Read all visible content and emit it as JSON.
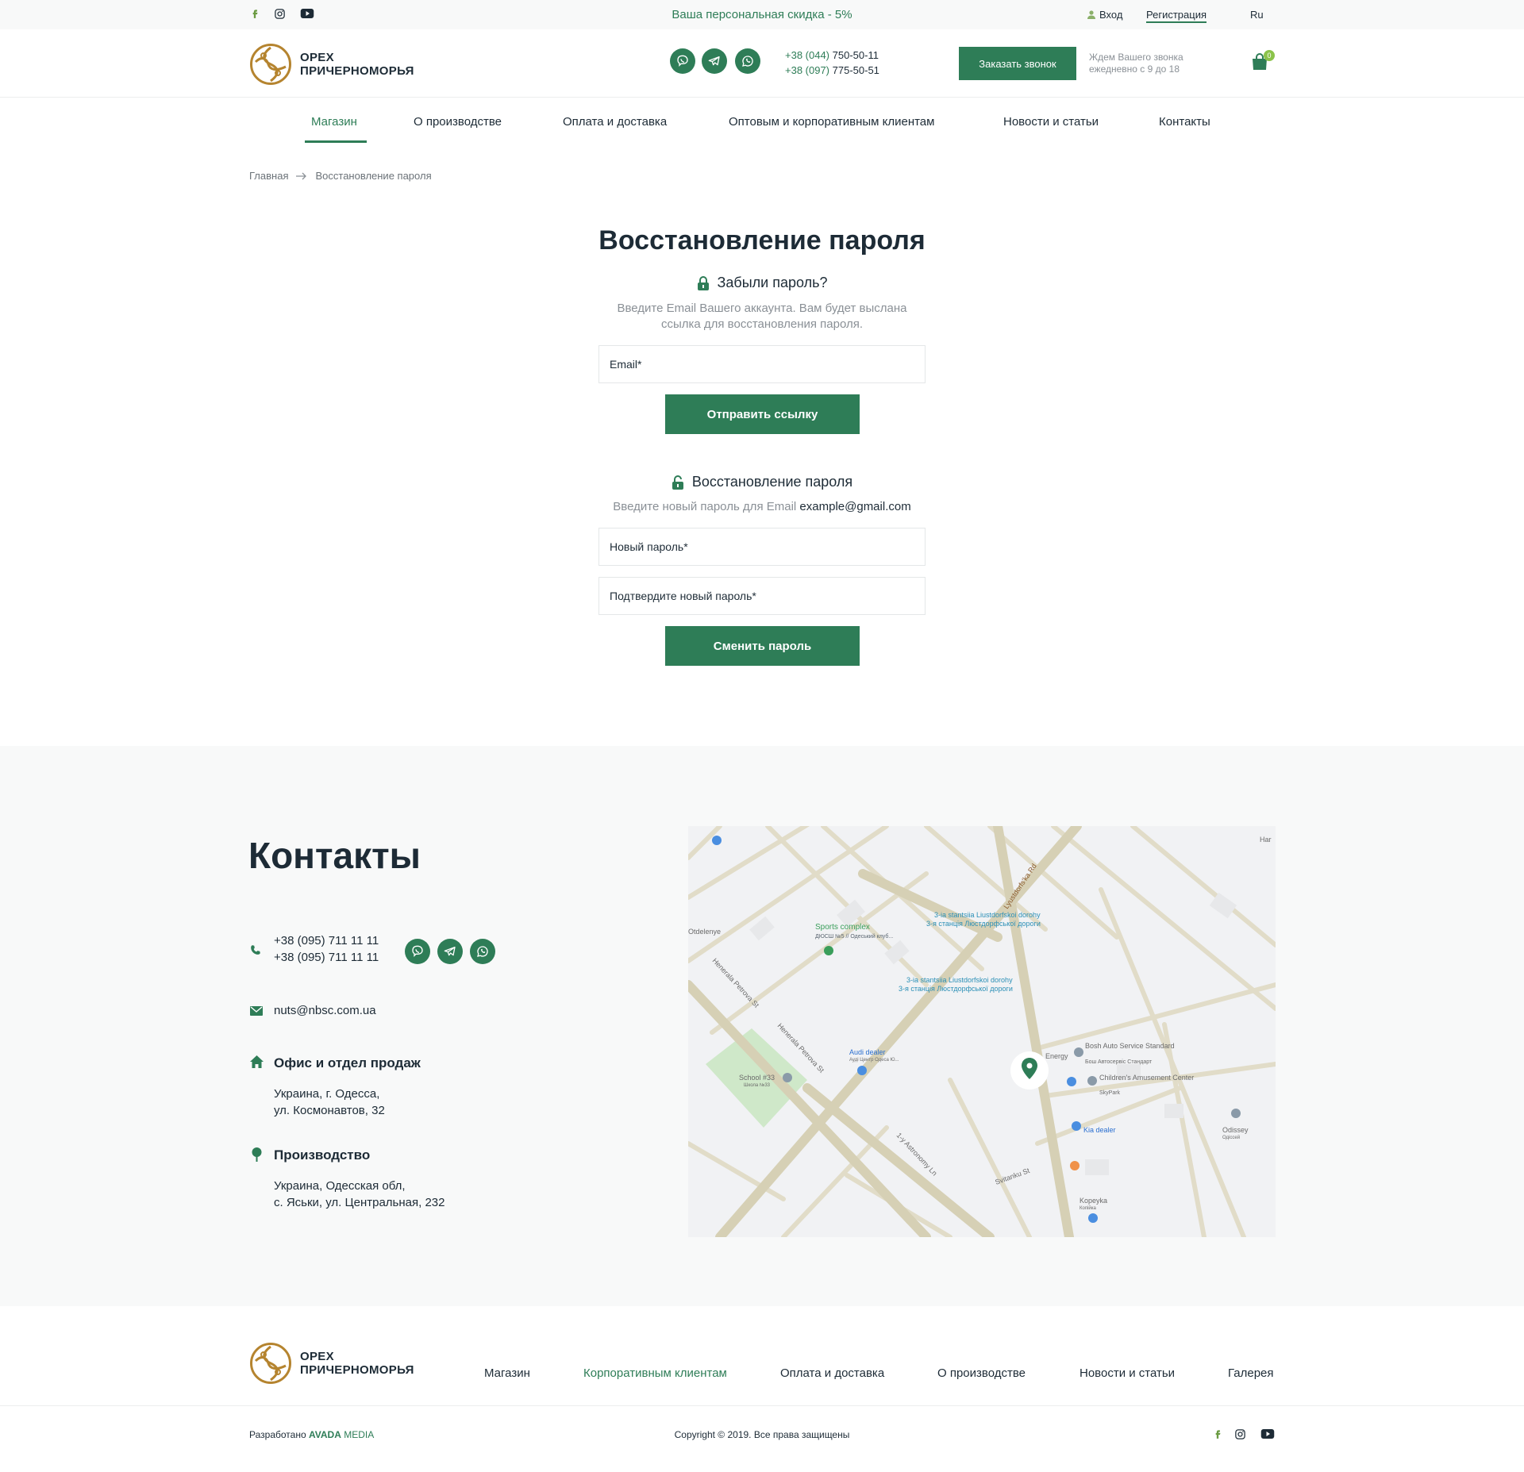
{
  "colors": {
    "accent": "#2e7d57",
    "gold": "#b5842f",
    "muted": "#8a9096"
  },
  "topbar": {
    "discount": "Ваша персональная скидка - 5%",
    "login": "Вход",
    "register": "Регистрация",
    "lang": "Ru",
    "social": [
      "facebook-icon",
      "instagram-icon",
      "youtube-icon"
    ]
  },
  "header": {
    "logo_line1": "ОРЕХ",
    "logo_line2": "ПРИЧЕРНОМОРЬЯ",
    "phone1_code": "+38 (044)",
    "phone1_number": "750-50-11",
    "phone2_code": "+38 (097)",
    "phone2_number": "775-50-51",
    "call_button": "Заказать звонок",
    "call_note_line1": "Ждем Вашего звонка",
    "call_note_line2": "ежедневно с 9 до 18",
    "cart_count": "0"
  },
  "nav": {
    "items": [
      "Магазин",
      "О производстве",
      "Оплата и доставка",
      "Оптовым и корпоративным клиентам",
      "Новости и статьи",
      "Контакты"
    ],
    "active": "Магазин"
  },
  "breadcrumb": {
    "home": "Главная",
    "current": "Восстановление пароля"
  },
  "main": {
    "title": "Восстановление пароля",
    "forgot": {
      "title": "Забыли пароль?",
      "hint_line1": "Введите Email Вашего аккаунта. Вам будет выслана",
      "hint_line2": "ссылка для восстановления пароля.",
      "email_placeholder": "Email*",
      "button": "Отправить ссылку"
    },
    "reset": {
      "title": "Восстановление пароля",
      "hint_prefix": "Введите новый пароль для Email",
      "hint_email": "example@gmail.com",
      "new_password_placeholder": "Новый пароль*",
      "confirm_password_placeholder": "Подтвердите новый пароль*",
      "button": "Сменить пароль"
    }
  },
  "contacts": {
    "title": "Контакты",
    "phone1": "+38 (095) 711 11 11",
    "phone2": "+38 (095) 711 11 11",
    "email": "nuts@nbsc.com.ua",
    "office_title": "Офис и отдел продаж",
    "office_line1": "Украина, г. Одесса,",
    "office_line2": "ул. Космонавтов, 32",
    "production_title": "Производство",
    "production_line1": "Украина, Одесская обл,",
    "production_line2": "с. Яськи, ул. Центральная, 232"
  },
  "map": {
    "labels": {
      "sports": "Sports complex",
      "sports_sub": "ДЮСШ №5 // Одеський клуб...",
      "station1": "3-ia stantsiia Liustdorfskoi dorohy",
      "station1_sub": "3-я станція Люстдорфської дороги",
      "station2": "3-ia stantsiia Liustdorfskoi dorohy",
      "station2_sub": "3-я станція Люстдорфської дороги",
      "street_lyust": "Lyustdorfs'ka Rd",
      "street_petrova1": "Henerala Petrova St",
      "street_petrova2": "Henerala Petrova St",
      "street_astronomy": "1-y Astronomy Ln",
      "street_svitanku": "Svitanku St",
      "audi": "Audi dealer",
      "audi_sub": "Ауді Центр Одеса Ю...",
      "school": "School #33",
      "school_sub": "Школа №33",
      "energy": "Energy",
      "bosh": "Bosh Auto Service Standard",
      "bosh_sub": "Бош Автосервіс Стандарт",
      "children": "Children's Amusement Center",
      "children_sub": "SkyPark",
      "kia": "Kia dealer",
      "odissey": "Odissey",
      "odissey_sub": "Одіссей",
      "kopeyka": "Kopeyka",
      "kopeyka_sub": "Копійка",
      "otdelenye": "Otdelenye",
      "har": "Har"
    }
  },
  "footer": {
    "logo_line1": "ОРЕХ",
    "logo_line2": "ПРИЧЕРНОМОРЬЯ",
    "nav": [
      "Магазин",
      "Корпоративным клиентам",
      "Оплата и доставка",
      "О производстве",
      "Новости и статьи",
      "Галерея"
    ],
    "active": "Корпоративным клиентам",
    "credits_prefix": "Разработано",
    "credits_brand": "AVADA",
    "credits_brand2": "MEDIA",
    "copyright": "Copyright © 2019. Все права защищены"
  }
}
